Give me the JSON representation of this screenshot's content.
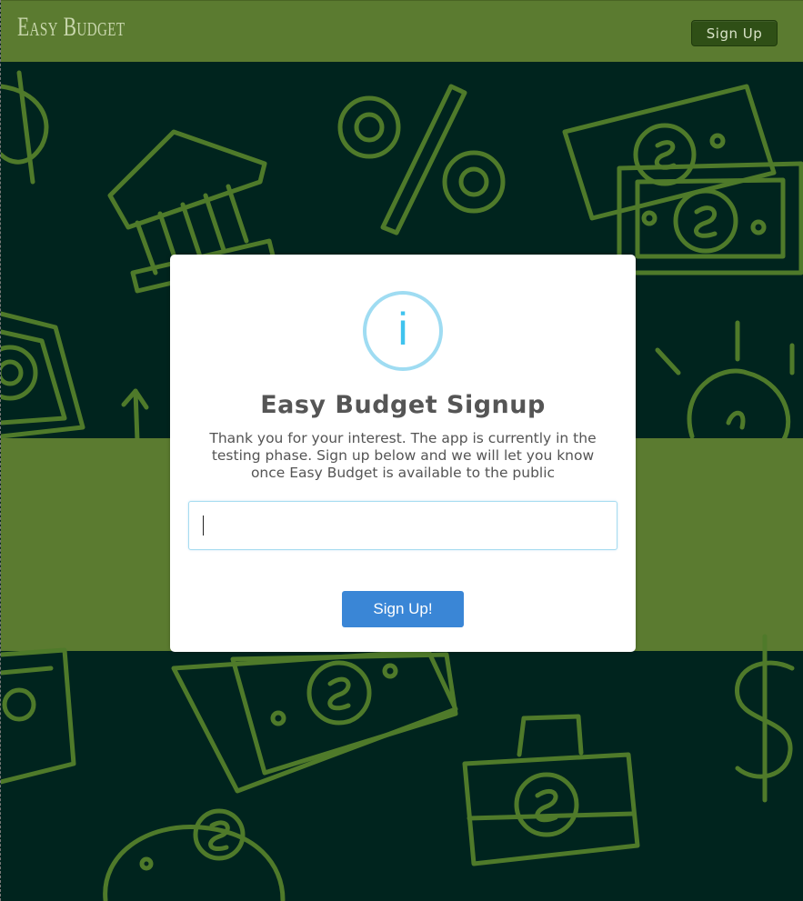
{
  "app": {
    "brand": "Easy Budget"
  },
  "navbar": {
    "signup_label": "Sign Up"
  },
  "modal": {
    "icon": "info-icon",
    "icon_glyph": "i",
    "title": "Easy Budget Signup",
    "message": "Thank you for your interest. The app is currently in the testing phase. Sign up below and we will let you know once Easy Budget is available to the public",
    "input_value": "",
    "submit_label": "Sign Up!"
  },
  "colors": {
    "navbar_bg": "#5b7b30",
    "page_bg": "#00241e",
    "pattern_stroke": "#4f7a2a",
    "accent_button": "#3a86d6",
    "info_ring": "#9fdcf2",
    "info_glyph": "#3fc3ee"
  }
}
